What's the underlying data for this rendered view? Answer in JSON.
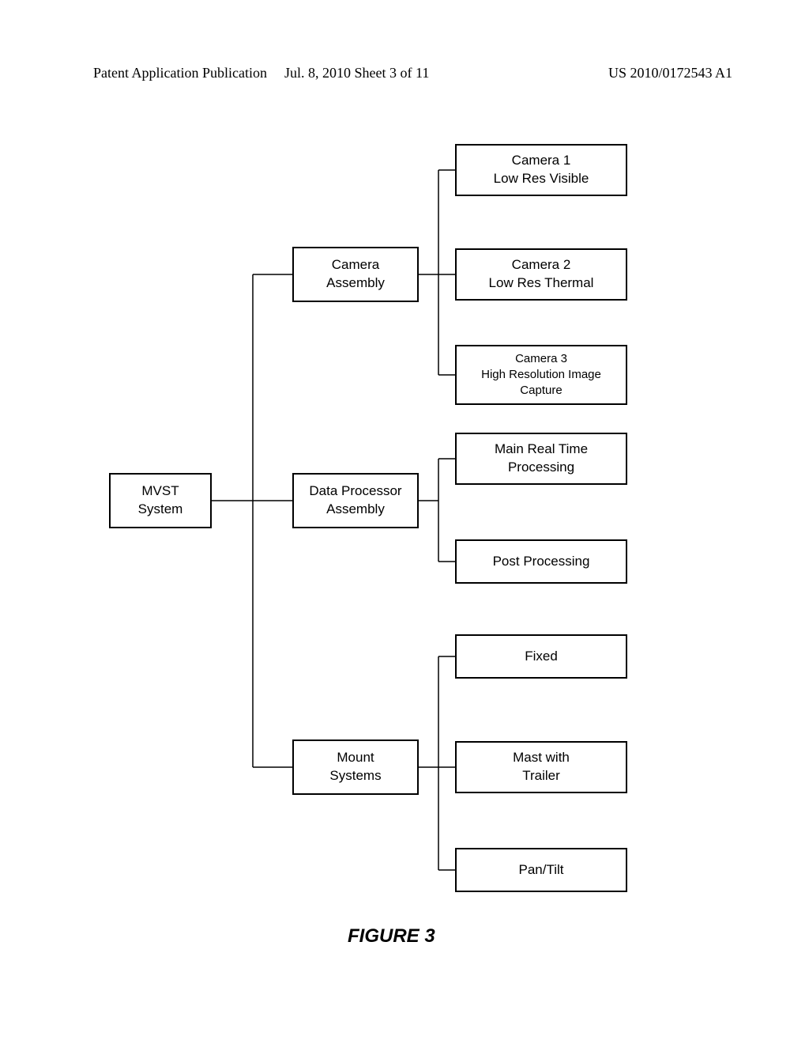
{
  "header": {
    "left": "Patent Application Publication",
    "date": "Jul. 8, 2010  Sheet 3 of 11",
    "pubno": "US 2010/0172543 A1"
  },
  "root": {
    "label": "MVST\nSystem"
  },
  "level2": {
    "camera": "Camera\nAssembly",
    "processor": "Data Processor\nAssembly",
    "mount": "Mount\nSystems"
  },
  "leaves": {
    "cam1": "Camera 1\nLow Res Visible",
    "cam2": "Camera 2\nLow Res Thermal",
    "cam3": "Camera 3\nHigh Resolution Image\nCapture",
    "proc1": "Main Real Time\nProcessing",
    "proc2": "Post Processing",
    "mount1": "Fixed",
    "mount2": "Mast with\nTrailer",
    "mount3": "Pan/Tilt"
  },
  "caption": "FIGURE 3"
}
